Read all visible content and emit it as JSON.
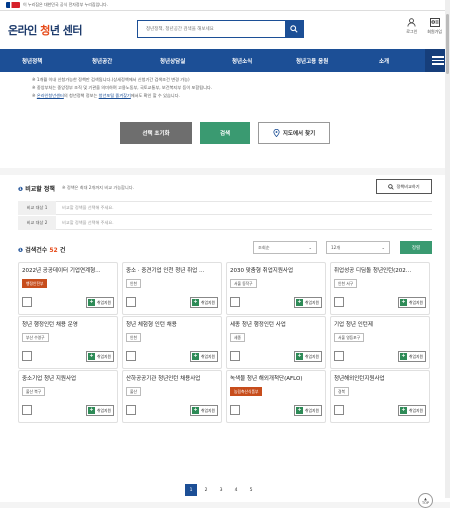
{
  "gov_banner": "이 누리집은 대한민국 공식 전자정부 누리집입니다.",
  "header": {
    "logo_main": "온라인 ",
    "logo_accent": "청",
    "logo_rest": "년 센터",
    "search_placeholder": "청년정책, 청년공간 검색을 해보세요",
    "login": "로그인",
    "join": "회원가입"
  },
  "nav": {
    "items": [
      "청년정책",
      "청년공간",
      "청년상담실",
      "청년소식",
      "청년고용 응원",
      "소개"
    ]
  },
  "notes": [
    "※ 1개월 이내 신청가능한 정책만 검색됩니다.(상세정책에서 신청기간 검색조건 변경 가능)",
    "※ 중앙부처는 중앙정부 조직 및 기관을 의미하며 고용노동부, 국토교통부, 보건복지부 등이 포함됩니다.",
    "※ 온라인청년센터의 청년정책 정보는 청년포털 즐겨찾기에서도 확인 할 수 있습니다."
  ],
  "notes_link1": "온라인청년센터",
  "notes_link2": "청년포털 즐겨찾기",
  "buttons": {
    "reset": "선택 초기화",
    "search": "검색",
    "map": "지도에서 찾기"
  },
  "compare": {
    "title": "비교할 정책",
    "sub": "※ 정책은 최대 2개까지 비교 가능합니다.",
    "button": "정책비교하기",
    "rows": [
      {
        "k": "비교 대상 1",
        "v": "비교할 정책을 선택해 주세요."
      },
      {
        "k": "비교 대상 2",
        "v": "비교할 정책을 선택해 주세요."
      }
    ]
  },
  "results": {
    "count_label": "검색건수",
    "count": "52",
    "count_unit": "건",
    "sort": "조회순",
    "per_page": "12개",
    "apply": "정렬"
  },
  "cards": [
    {
      "title": "2022년 공공데이터 기업연계형…",
      "tag": "행정안전부",
      "hot": true
    },
    {
      "title": "중소 · 중견기업 인천 청년 취업 …",
      "tag": "인천",
      "hot": false
    },
    {
      "title": "2030 맞춤형 취업지원사업",
      "tag": "서울 동작구",
      "hot": false
    },
    {
      "title": "취업성공 디딤돌 청년인턴(202…",
      "tag": "인천 서구",
      "hot": false
    },
    {
      "title": "청년 행정인턴 채용 운영",
      "tag": "부산 수영구",
      "hot": false
    },
    {
      "title": "청년 체험형 인턴 채용",
      "tag": "인천",
      "hot": false
    },
    {
      "title": "세종 청년 행정인턴 사업",
      "tag": "세종",
      "hot": false
    },
    {
      "title": "기업 청년 인턴제",
      "tag": "서울 영등포구",
      "hot": false
    },
    {
      "title": "중소기업 청년 지원사업",
      "tag": "울산 북구",
      "hot": false
    },
    {
      "title": "산하공공기관 청년인턴 채용사업",
      "tag": "울산",
      "hot": false
    },
    {
      "title": "녹색물 청년 해외개척단(AFLO)",
      "tag": "농림축산식품부",
      "hot": true
    },
    {
      "title": "청년해외인턴지원사업",
      "tag": "경북",
      "hot": false
    }
  ],
  "card_action": "취업지원",
  "pages": [
    "1",
    "2",
    "3",
    "4",
    "5"
  ],
  "top": "TOP",
  "colors": {
    "primary": "#1c4f96",
    "accent": "#e64a19",
    "green": "#3a9a71",
    "hot_tag": "#c74d1c"
  }
}
